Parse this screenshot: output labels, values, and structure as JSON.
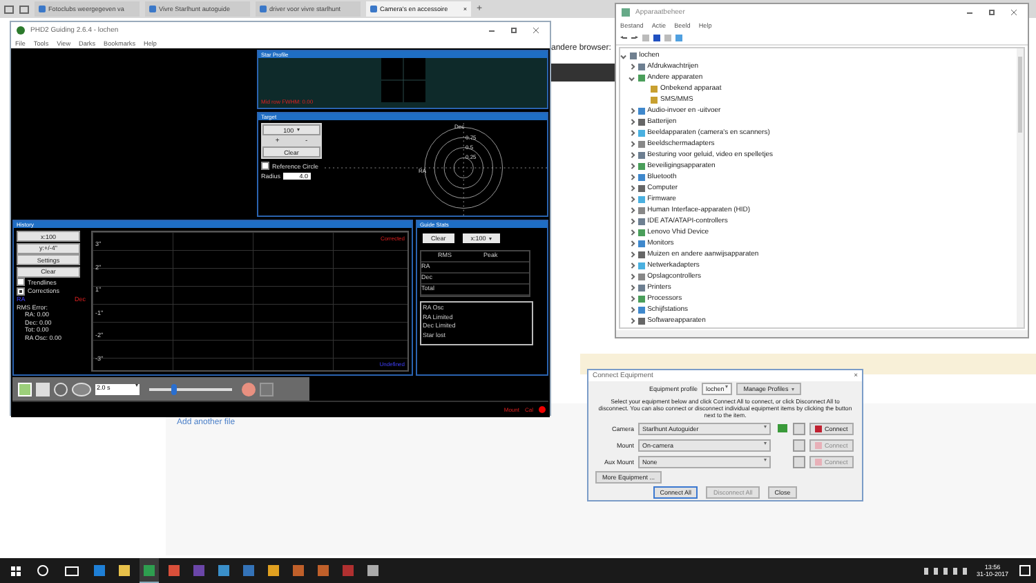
{
  "browser": {
    "tabs": [
      {
        "label": "Fotoclubs weergegeven va",
        "selected": false
      },
      {
        "label": "Vivre Starlhunt autoguide",
        "selected": false
      },
      {
        "label": "driver voor vivre starlhunt",
        "selected": false
      },
      {
        "label": "Camera's en accessoire",
        "selected": true
      }
    ],
    "close": "×",
    "new_tab": "+",
    "page_text": "andere browser:",
    "link": "Add another file"
  },
  "phd": {
    "title": "PHD2 Guiding 2.6.4 - lochen",
    "menu": [
      "File",
      "Tools",
      "View",
      "Darks",
      "Bookmarks",
      "Help"
    ],
    "star_profile": {
      "title": "Star Profile",
      "readout": "Mid row FWHM: 0.00"
    },
    "target": {
      "title": "Target",
      "scale": "100",
      "plus": "+",
      "minus": "-",
      "clear": "Clear",
      "reference_circle": {
        "label": "Reference Circle",
        "checked": false
      },
      "radius_label": "Radius",
      "radius": "4.0",
      "axis_dec": "Dec",
      "axis_ra": "RA",
      "rings": [
        "0.75",
        "0.5",
        "0.25"
      ]
    },
    "history": {
      "title": "History",
      "buttons": [
        "x:100",
        "y:+/-4\"",
        "Settings",
        "Clear"
      ],
      "checks": [
        {
          "label": "Trendlines",
          "checked": false
        },
        {
          "label": "Corrections",
          "checked": true
        }
      ],
      "legend_ra": "RA",
      "legend_dec": "Dec",
      "rms_title": "RMS Error:",
      "rms": [
        "RA: 0.00",
        "Dec: 0.00",
        "Tot: 0.00",
        "RA Osc: 0.00"
      ],
      "y_labels": [
        "3\"",
        "2\"",
        "1\"",
        "-1\"",
        "-2\"",
        "-3\""
      ],
      "top_label": "Corrected",
      "bottom_label": "Undefined"
    },
    "guide_stats": {
      "title": "Guide Stats",
      "clear": "Clear",
      "scale": "x:100",
      "columns": [
        "RMS",
        "Peak"
      ],
      "rows": [
        "RA",
        "Dec",
        "Total"
      ],
      "list": [
        "RA Osc",
        "RA Limited",
        "Dec Limited",
        "Star lost"
      ]
    },
    "toolbar": {
      "exposure": "2.0 s",
      "slider": {
        "level": 0.3
      }
    },
    "status": [
      "Mount",
      "Cal"
    ]
  },
  "device_manager": {
    "title": "Apparaatbeheer",
    "menu": [
      "Bestand",
      "Actie",
      "Beeld",
      "Help"
    ],
    "tree": {
      "label": "lochen",
      "expanded": true,
      "children": [
        {
          "label": "Afdrukwachtrijen",
          "expanded": false
        },
        {
          "label": "Andere apparaten",
          "expanded": true,
          "children": [
            {
              "label": "Onbekend apparaat"
            },
            {
              "label": "SMS/MMS"
            }
          ]
        },
        {
          "label": "Audio-invoer en -uitvoer",
          "expanded": false
        },
        {
          "label": "Batterijen",
          "expanded": false
        },
        {
          "label": "Beeldapparaten (camera's en scanners)",
          "expanded": false
        },
        {
          "label": "Beeldschermadapters",
          "expanded": false
        },
        {
          "label": "Besturing voor geluid, video en spelletjes",
          "expanded": false
        },
        {
          "label": "Beveiligingsapparaten",
          "expanded": false
        },
        {
          "label": "Bluetooth",
          "expanded": false
        },
        {
          "label": "Computer",
          "expanded": false
        },
        {
          "label": "Firmware",
          "expanded": false
        },
        {
          "label": "Human Interface-apparaten (HID)",
          "expanded": false
        },
        {
          "label": "IDE ATA/ATAPI-controllers",
          "expanded": false
        },
        {
          "label": "Lenovo Vhid Device",
          "expanded": false
        },
        {
          "label": "Monitors",
          "expanded": false
        },
        {
          "label": "Muizen en andere aanwijsapparaten",
          "expanded": false
        },
        {
          "label": "Netwerkadapters",
          "expanded": false
        },
        {
          "label": "Opslagcontrollers",
          "expanded": false
        },
        {
          "label": "Printers",
          "expanded": false
        },
        {
          "label": "Processors",
          "expanded": false
        },
        {
          "label": "Schijfstations",
          "expanded": false
        },
        {
          "label": "Softwareapparaten",
          "expanded": false
        }
      ]
    }
  },
  "connect": {
    "title": "Connect Equipment",
    "close": "×",
    "profile_label": "Equipment profile",
    "profile": "lochen",
    "manage": "Manage Profiles",
    "intro": "Select your equipment below and click Connect All to connect, or click Disconnect All to disconnect. You can also connect or disconnect individual equipment items by clicking the button next to the item.",
    "rows": [
      {
        "label": "Camera",
        "value": "Starlhunt Autoguider",
        "button": "Connect",
        "disabled": false
      },
      {
        "label": "Mount",
        "value": "On-camera",
        "button": "Connect",
        "disabled": true
      },
      {
        "label": "Aux Mount",
        "value": "None",
        "button": "Connect",
        "disabled": true
      }
    ],
    "more": "More Equipment ...",
    "buttons": [
      {
        "label": "Connect All",
        "disabled": false
      },
      {
        "label": "Disconnect All",
        "disabled": true
      },
      {
        "label": "Close",
        "disabled": false
      }
    ]
  },
  "taskbar": {
    "time": "13:56",
    "date": "31-10-2017"
  }
}
